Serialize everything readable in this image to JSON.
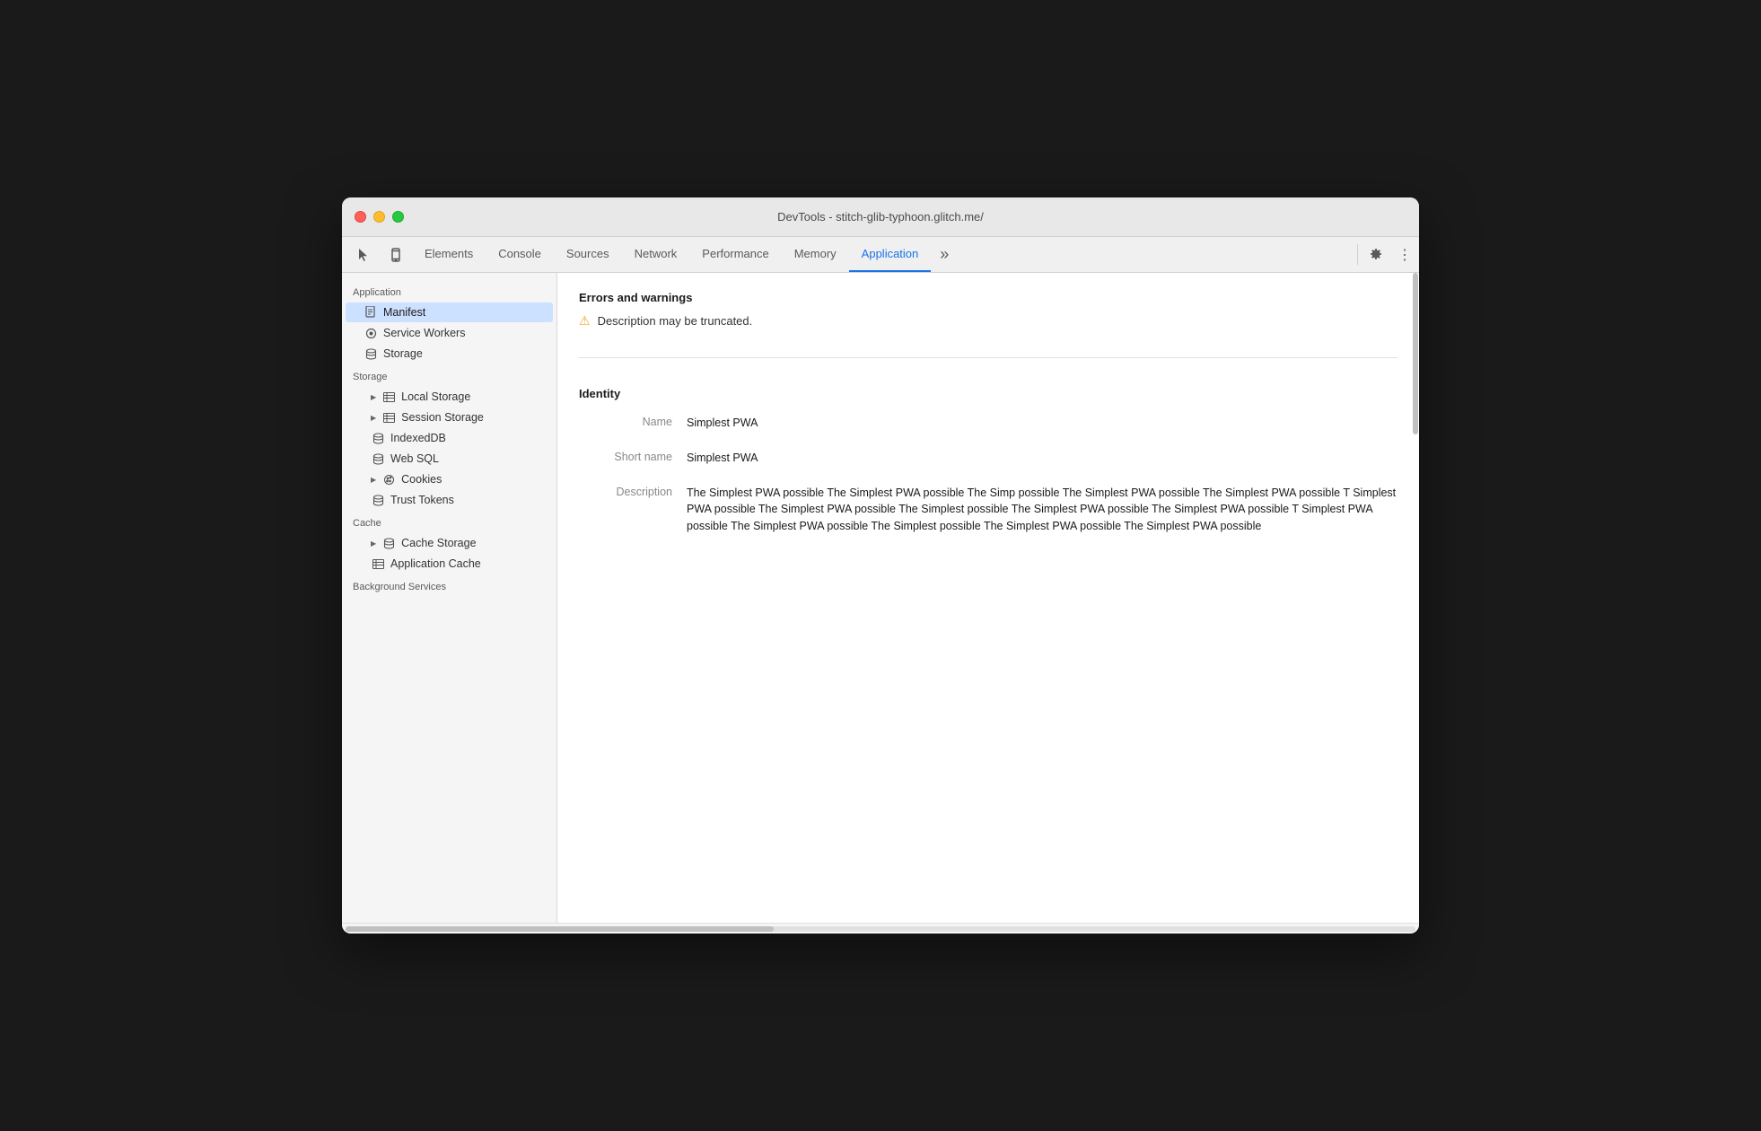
{
  "window": {
    "title": "DevTools - stitch-glib-typhoon.glitch.me/"
  },
  "tabs": {
    "items": [
      {
        "label": "Elements",
        "active": false
      },
      {
        "label": "Console",
        "active": false
      },
      {
        "label": "Sources",
        "active": false
      },
      {
        "label": "Network",
        "active": false
      },
      {
        "label": "Performance",
        "active": false
      },
      {
        "label": "Memory",
        "active": false
      },
      {
        "label": "Application",
        "active": true
      }
    ],
    "more": "»",
    "gear": "⚙",
    "dots": "⋮"
  },
  "sidebar": {
    "app_section": "Application",
    "items_app": [
      {
        "label": "Manifest",
        "icon": "📄",
        "active": true
      },
      {
        "label": "Service Workers",
        "icon": "⚙",
        "active": false
      },
      {
        "label": "Storage",
        "icon": "🗄",
        "active": false
      }
    ],
    "storage_section": "Storage",
    "items_storage": [
      {
        "label": "Local Storage",
        "icon": "▦",
        "has_arrow": true
      },
      {
        "label": "Session Storage",
        "icon": "▦",
        "has_arrow": true
      },
      {
        "label": "IndexedDB",
        "icon": "🗄"
      },
      {
        "label": "Web SQL",
        "icon": "🗄"
      },
      {
        "label": "Cookies",
        "icon": "🍪",
        "has_arrow": true
      },
      {
        "label": "Trust Tokens",
        "icon": "🗄"
      }
    ],
    "cache_section": "Cache",
    "items_cache": [
      {
        "label": "Cache Storage",
        "icon": "🗄",
        "has_arrow": true
      },
      {
        "label": "Application Cache",
        "icon": "▦"
      }
    ],
    "background_section": "Background Services"
  },
  "panel": {
    "errors_title": "Errors and warnings",
    "warning_text": "Description may be truncated.",
    "identity_title": "Identity",
    "fields": [
      {
        "label": "Name",
        "value": "Simplest PWA"
      },
      {
        "label": "Short name",
        "value": "Simplest PWA"
      },
      {
        "label": "Description",
        "value": "The Simplest PWA possible The Simplest PWA possible The Simp possible The Simplest PWA possible The Simplest PWA possible T Simplest PWA possible The Simplest PWA possible The Simplest possible The Simplest PWA possible The Simplest PWA possible T Simplest PWA possible The Simplest PWA possible The Simplest possible The Simplest PWA possible The Simplest PWA possible"
      }
    ]
  },
  "icons": {
    "cursor": "↖",
    "mobile": "📱",
    "arrow_right": "▶",
    "warning": "⚠"
  }
}
